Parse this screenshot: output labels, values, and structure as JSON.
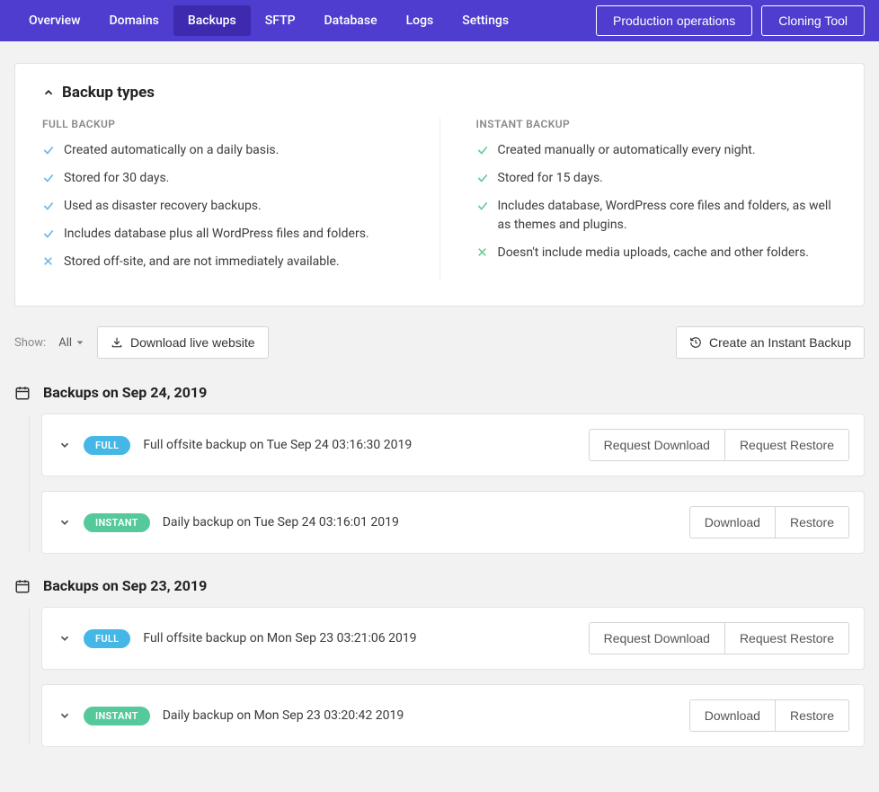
{
  "nav": {
    "tabs": [
      "Overview",
      "Domains",
      "Backups",
      "SFTP",
      "Database",
      "Logs",
      "Settings"
    ],
    "active": "Backups",
    "buttons": {
      "prod": "Production operations",
      "cloning": "Cloning Tool"
    }
  },
  "types_card": {
    "title": "Backup types",
    "full": {
      "head": "FULL BACKUP",
      "items": [
        {
          "ok": true,
          "text": "Created automatically on a daily basis."
        },
        {
          "ok": true,
          "text": "Stored for 30 days."
        },
        {
          "ok": true,
          "text": "Used as disaster recovery backups."
        },
        {
          "ok": true,
          "text": "Includes database plus all WordPress files and folders."
        },
        {
          "ok": false,
          "text": "Stored off-site, and are not immediately available."
        }
      ]
    },
    "instant": {
      "head": "INSTANT BACKUP",
      "items": [
        {
          "ok": true,
          "text": "Created manually or automatically every night."
        },
        {
          "ok": true,
          "text": "Stored for 15 days."
        },
        {
          "ok": true,
          "text": "Includes database, WordPress core files and folders, as well as themes and plugins."
        },
        {
          "ok": false,
          "text": "Doesn't include media uploads, cache and other folders."
        }
      ]
    }
  },
  "toolbar": {
    "show_label": "Show:",
    "show_value": "All",
    "download_live": "Download live website",
    "create_instant": "Create an Instant Backup"
  },
  "badge": {
    "full": "FULL",
    "instant": "INSTANT"
  },
  "buttons": {
    "request_download": "Request Download",
    "request_restore": "Request Restore",
    "download": "Download",
    "restore": "Restore"
  },
  "groups": [
    {
      "title": "Backups on Sep 24, 2019",
      "rows": [
        {
          "type": "full",
          "desc": "Full offsite backup on Tue Sep 24 03:16:30 2019"
        },
        {
          "type": "instant",
          "desc": "Daily backup on Tue Sep 24 03:16:01 2019"
        }
      ]
    },
    {
      "title": "Backups on Sep 23, 2019",
      "rows": [
        {
          "type": "full",
          "desc": "Full offsite backup on Mon Sep 23 03:21:06 2019"
        },
        {
          "type": "instant",
          "desc": "Daily backup on Mon Sep 23 03:20:42 2019"
        }
      ]
    }
  ]
}
